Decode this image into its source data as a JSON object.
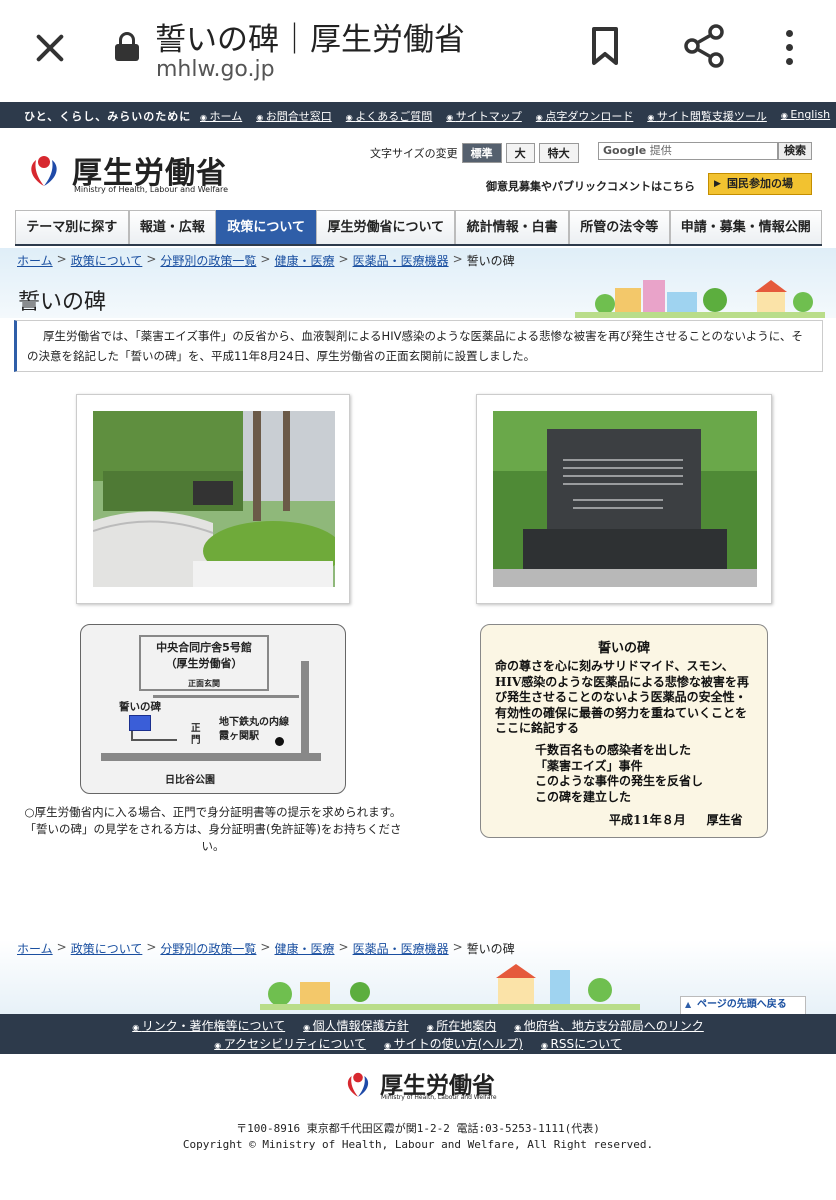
{
  "browser": {
    "page_title": "誓いの碑｜厚生労働省",
    "url": "mhlw.go.jp",
    "icons": [
      "close-icon",
      "lock-icon",
      "bookmark-icon",
      "share-icon",
      "more-vert-icon"
    ]
  },
  "topbar": {
    "tagline": "ひと、くらし、みらいのために",
    "links": [
      "ホーム",
      "お問合せ窓口",
      "よくあるご質問",
      "サイトマップ",
      "点字ダウンロード",
      "サイト閲覧支援ツール",
      "English"
    ]
  },
  "header": {
    "logo_name": "厚生労働省",
    "logo_en": "Ministry of Health, Labour and Welfare",
    "fontsize_label": "文字サイズの変更",
    "fontsize_options": [
      "標準",
      "大",
      "特大"
    ],
    "search_brand": "Google",
    "search_provided": "提供",
    "search_button": "検索",
    "pubcomment": "御意見募集やパブリックコメントはこちら",
    "kokumin": "国民参加の場"
  },
  "gnav": [
    "テーマ別に探す",
    "報道・広報",
    "政策について",
    "厚生労働省について",
    "統計情報・白書",
    "所管の法令等",
    "申請・募集・情報公開"
  ],
  "gnav_active_index": 2,
  "breadcrumb": {
    "links": [
      "ホーム",
      "政策について",
      "分野別の政策一覧",
      "健康・医療",
      "医薬品・医療機器"
    ],
    "current": "誓いの碑",
    "sep": ">"
  },
  "page_heading": "誓いの碑",
  "intro": "厚生労働省では、「薬害エイズ事件」の反省から、血液製剤によるHIV感染のような医薬品による悲惨な被害を再び発生させることのないように、その決意を銘記した「誓いの碑」を、平成11年8月24日、厚生労働省の正面玄関前に設置しました。",
  "map": {
    "building_line1": "中央合同庁舎5号館",
    "building_line2": "（厚生労働省）",
    "entrance": "正面玄関",
    "monument": "誓いの碑",
    "gate": "正門",
    "station_line1": "地下鉄丸の内線",
    "station_line2": "霞ヶ関駅",
    "park": "日比谷公園"
  },
  "inscription": {
    "title": "誓いの碑",
    "body": "命の尊さを心に刻みサリドマイド、スモン、HIV感染のような医薬品による悲惨な被害を再び発生させることのないよう医薬品の安全性・有効性の確保に最善の努力を重ねていくことをここに銘記する",
    "line1": "千数百名もの感染者を出した",
    "line2": "「薬害エイズ」事件",
    "line3": "このような事件の発生を反省し",
    "line4": "この碑を建立した",
    "date": "平成11年８月",
    "signer": "厚生省"
  },
  "notes": {
    "line1": "○厚生労働省内に入る場合、正門で身分証明書等の提示を求められます。",
    "line2": "「誓いの碑」の見学をされる方は、身分証明書(免許証等)をお持ちください。"
  },
  "pagetop": "ページの先頭へ戻る",
  "footnav": {
    "row1": [
      "リンク・著作権等について",
      "個人情報保護方針",
      "所在地案内",
      "他府省、地方支分部局へのリンク"
    ],
    "row2": [
      "アクセシビリティについて",
      "サイトの使い方(ヘルプ)",
      "RSSについて"
    ]
  },
  "footer": {
    "logo_name": "厚生労働省",
    "logo_en": "Ministry of Health, Labour and Welfare",
    "address": "〒100-8916 東京都千代田区霞が関1-2-2 電話:03-5253-1111(代表)",
    "copyright": "Copyright © Ministry of Health, Labour and Welfare, All Right reserved."
  },
  "colors": {
    "nav_dark": "#2d3a4b",
    "active_blue": "#2f5ea8",
    "link_blue": "#1a4fa0",
    "logo_red": "#d7282f",
    "logo_blue": "#1f4aa8"
  }
}
